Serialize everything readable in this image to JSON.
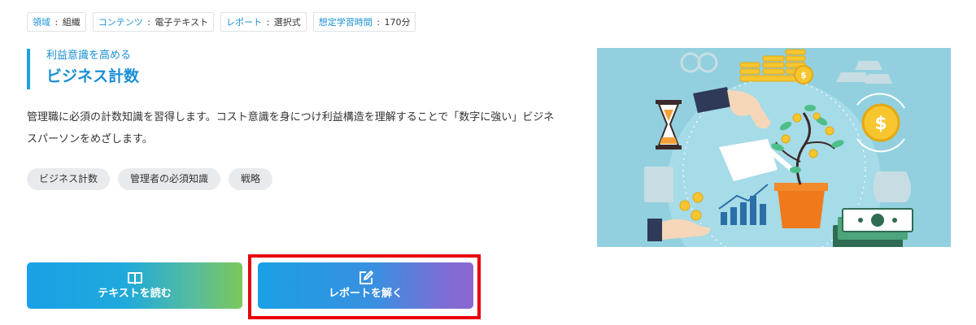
{
  "meta_tags": [
    {
      "key": "領域",
      "value": "組織"
    },
    {
      "key": "コンテンツ",
      "value": "電子テキスト"
    },
    {
      "key": "レポート",
      "value": "選択式"
    },
    {
      "key": "想定学習時間",
      "value": "170分"
    }
  ],
  "heading": {
    "subtitle": "利益意識を高める",
    "title": "ビジネス計数"
  },
  "description": "管理職に必須の計数知識を習得します。コスト意識を身につけ利益構造を理解することで「数字に強い」ビジネスパーソンをめざします。",
  "keywords": [
    "ビジネス計数",
    "管理者の必須知識",
    "戦略"
  ],
  "buttons": {
    "read_text": {
      "label": "テキストを読む",
      "icon": "book-icon"
    },
    "report": {
      "label": "レポートを解く",
      "icon": "edit-icon"
    }
  },
  "colors": {
    "accent": "#1a8fd6",
    "illustration_bg": "#92d0df",
    "highlight": "#e8000b"
  }
}
